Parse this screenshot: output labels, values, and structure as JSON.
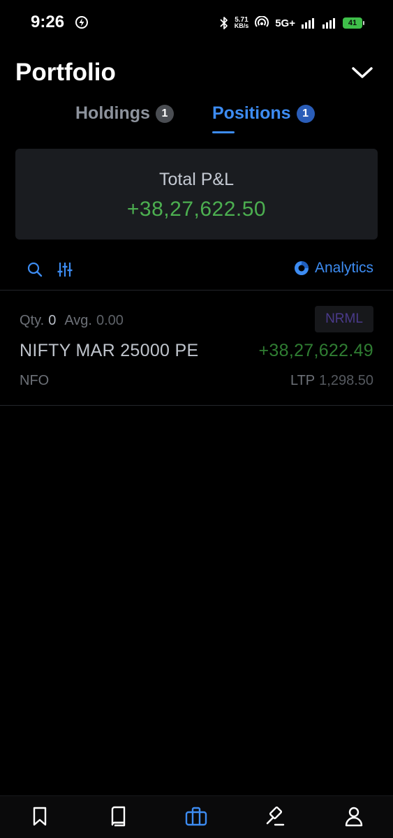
{
  "status_bar": {
    "time": "9:26",
    "net_speed_value": "5.71",
    "net_speed_unit": "KB/s",
    "network": "5G+",
    "battery": "41"
  },
  "header": {
    "title": "Portfolio",
    "collapse_icon": "chevron-down-icon"
  },
  "tabs": [
    {
      "label": "Holdings",
      "badge": "1",
      "active": false
    },
    {
      "label": "Positions",
      "badge": "1",
      "active": true
    }
  ],
  "summary": {
    "label": "Total P&L",
    "value": "+38,27,622.50"
  },
  "toolbar": {
    "search_icon": "search-icon",
    "filter_icon": "sliders-icon",
    "analytics_label": "Analytics"
  },
  "positions": [
    {
      "qty_label": "Qty.",
      "qty": "0",
      "avg_label": "Avg.",
      "avg": "0.00",
      "product": "NRML",
      "instrument": "NIFTY MAR 25000 PE",
      "pnl": "+38,27,622.49",
      "exchange": "NFO",
      "ltp_label": "LTP",
      "ltp": "1,298.50"
    }
  ],
  "bottom_nav": [
    {
      "icon": "bookmark-icon",
      "active": false
    },
    {
      "icon": "book-icon",
      "active": false
    },
    {
      "icon": "briefcase-icon",
      "active": true
    },
    {
      "icon": "gavel-icon",
      "active": false
    },
    {
      "icon": "user-icon",
      "active": false
    }
  ],
  "colors": {
    "accent": "#3d8cf2",
    "profit": "#4caf50",
    "card_bg": "#1a1c20",
    "background": "#000000"
  }
}
